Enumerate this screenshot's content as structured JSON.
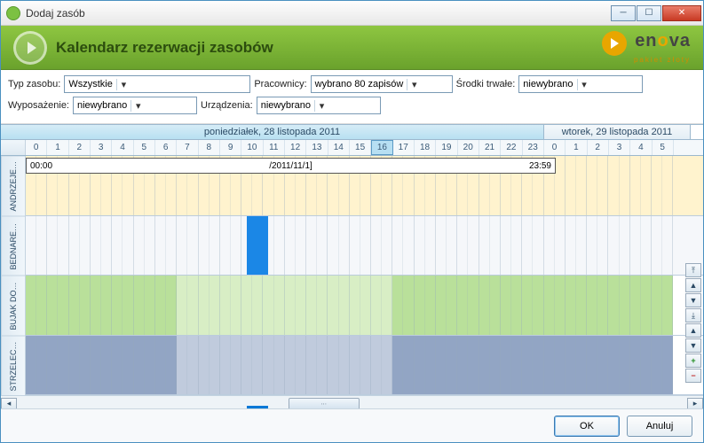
{
  "window": {
    "title": "Dodaj zasób"
  },
  "header": {
    "title": "Kalendarz rezerwacji zasobów",
    "logo_brand": "enova",
    "logo_sub": "pakiet złoty"
  },
  "filters": {
    "typ_label": "Typ zasobu:",
    "typ_value": "Wszystkie",
    "prac_label": "Pracownicy:",
    "prac_value": "wybrano 80 zapisów",
    "srodki_label": "Środki trwałe:",
    "srodki_value": "niewybrano",
    "wypos_label": "Wyposażenie:",
    "wypos_value": "niewybrano",
    "urz_label": "Urządzenia:",
    "urz_value": "niewybrano"
  },
  "dates": {
    "d1": "poniedziałek, 28 listopada 2011",
    "d2": "wtorek, 29 listopada 2011"
  },
  "selected_hour": 16,
  "rows": {
    "r0": "ANDRZEJE…",
    "r1": "BEDNARE…",
    "r2": "BUJAK DO…",
    "r3": "STRZELEC…"
  },
  "booking": {
    "start": "00:00",
    "mid": "/2011/11/1]",
    "end": "23:59"
  },
  "buttons": {
    "ok": "OK",
    "cancel": "Anuluj"
  }
}
